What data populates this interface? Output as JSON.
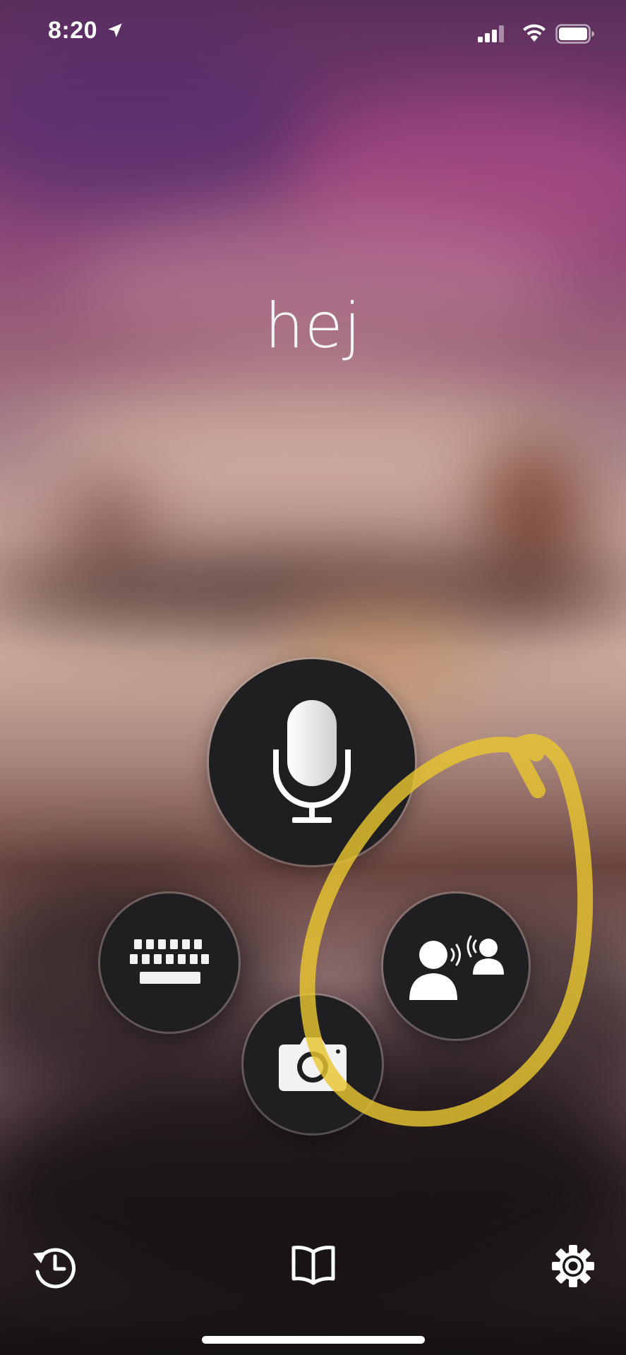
{
  "status_bar": {
    "time": "8:20",
    "location_icon": "location-arrow-icon",
    "signal_icon": "cellular-signal-icon",
    "wifi_icon": "wifi-icon",
    "battery_icon": "battery-icon"
  },
  "main": {
    "prompt_text": "hej"
  },
  "buttons": {
    "microphone": "microphone-icon",
    "keyboard": "keyboard-icon",
    "conversation": "conversation-icon",
    "camera": "camera-icon"
  },
  "bottom_bar": {
    "history": "history-icon",
    "phrasebook": "book-icon",
    "settings": "gear-icon"
  },
  "colors": {
    "button_bg": "#1f1f21",
    "highlight": "#e8c62f"
  }
}
